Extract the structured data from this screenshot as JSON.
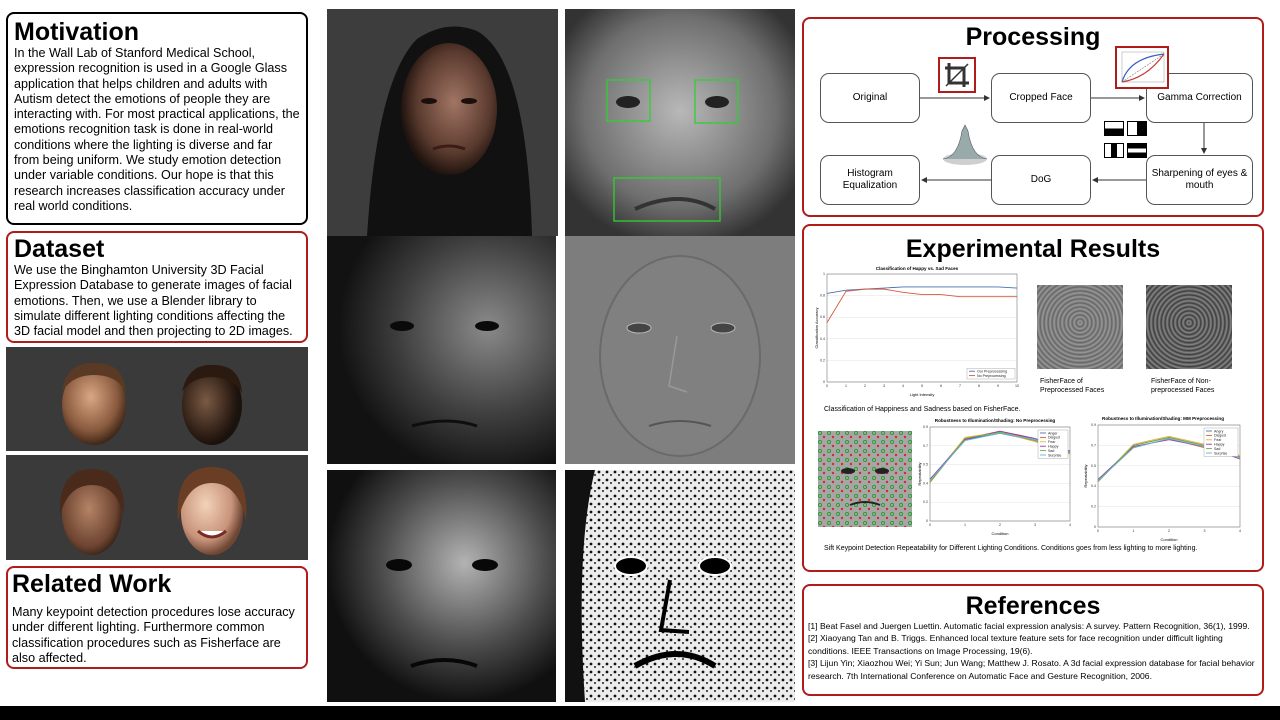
{
  "motivation": {
    "title": "Motivation",
    "body": "In the Wall Lab of Stanford Medical School, expression recognition is used in a Google Glass application that helps children and adults with Autism detect the emotions of people they are interacting with. For most practical applications, the emotions recognition task is done in real-world conditions where the lighting is diverse and far from being uniform. We study emotion detection under variable conditions. Our hope is that this research increases classification accuracy under real world conditions."
  },
  "dataset": {
    "title": "Dataset",
    "body": "We use the Binghamton University 3D Facial Expression Database to generate images of facial emotions. Then, we use a Blender library to simulate different lighting conditions affecting the 3D facial model and then projecting to 2D images."
  },
  "related_work": {
    "title": "Related Work",
    "body": "Many keypoint detection procedures lose accuracy under different lighting. Furthermore common classification procedures such as Fisherface are also affected."
  },
  "processing": {
    "title": "Processing",
    "nodes": {
      "original": "Original",
      "cropped": "Cropped Face",
      "gamma": "Gamma Correction",
      "histogram": "Histogram Equalization",
      "dog": "DoG",
      "sharpen": "Sharpening of eyes & mouth"
    }
  },
  "results": {
    "title": "Experimental Results",
    "fisher_caption": "Classification of Happiness and Sadness based on FisherFace.",
    "fisher_pre_caption": "FisherFace of Preprocessed Faces",
    "fisher_nonpre_caption": "FisherFace of Non-preprocessed Faces",
    "sift_caption": "Sift Keypoint Detection Repeatability for Different Lighting Conditions. Conditions goes from less lighting to more lighting."
  },
  "references": {
    "title": "References",
    "items": [
      "[1] Beat Fasel and Juergen Luettin. Automatic facial expression analysis: A survey. Pattern Recognition, 36(1), 1999.",
      "[2]  Xiaoyang Tan and B. Triggs. Enhanced local texture feature sets for face recognition under difficult lighting conditions. IEEE Transactions on Image Processing, 19(6).",
      "[3]  Lijun Yin; Xiaozhou Wei; Yi Sun; Jun Wang; Matthew J. Rosato. A 3d facial expression database for facial behavior research. 7th International Conference on Automatic Face and Gesture Recognition, 2006."
    ]
  },
  "chart_data": [
    {
      "type": "line",
      "title": "Classification of Happy vs. Sad Faces",
      "xlabel": "Light Intensity",
      "ylabel": "Classification Accuracy",
      "x": [
        0,
        1,
        2,
        3,
        4,
        5,
        6,
        7,
        8,
        9,
        10
      ],
      "xlim": [
        0,
        10
      ],
      "ylim": [
        0,
        1
      ],
      "legend": "bottom-right",
      "series": [
        {
          "name": "Our Preprocessing",
          "color": "#4a6fb3",
          "values": [
            0.82,
            0.85,
            0.86,
            0.87,
            0.88,
            0.88,
            0.88,
            0.88,
            0.88,
            0.88,
            0.87
          ]
        },
        {
          "name": "No Preprocessing",
          "color": "#d35b3c",
          "values": [
            0.55,
            0.84,
            0.86,
            0.86,
            0.83,
            0.81,
            0.81,
            0.79,
            0.79,
            0.79,
            0.79
          ]
        }
      ]
    },
    {
      "type": "line",
      "title": "Robustness to Illumination/Shading: No Preprocessing",
      "xlabel": "Condition",
      "ylabel": "Repeatability",
      "x": [
        0,
        1,
        2,
        3,
        4
      ],
      "xlim": [
        0,
        4
      ],
      "ylim": [
        0,
        0.9
      ],
      "legend": "top-right",
      "series": [
        {
          "name": "Anger",
          "color": "#4a6fb3",
          "values": [
            0.38,
            0.78,
            0.84,
            0.77,
            0.65
          ]
        },
        {
          "name": "Disgust",
          "color": "#d35b3c",
          "values": [
            0.37,
            0.79,
            0.86,
            0.78,
            0.66
          ]
        },
        {
          "name": "Fear",
          "color": "#e8b03a",
          "values": [
            0.38,
            0.8,
            0.85,
            0.76,
            0.64
          ]
        },
        {
          "name": "Happy",
          "color": "#8e3fa0",
          "values": [
            0.4,
            0.78,
            0.86,
            0.79,
            0.67
          ]
        },
        {
          "name": "Sad",
          "color": "#7aa83a",
          "values": [
            0.37,
            0.79,
            0.85,
            0.77,
            0.65
          ]
        },
        {
          "name": "Surprise",
          "color": "#5bb8d6",
          "values": [
            0.39,
            0.77,
            0.84,
            0.78,
            0.66
          ]
        }
      ]
    },
    {
      "type": "line",
      "title": "Robustness to Illumination/Shading: MM Preprocessing",
      "xlabel": "Condition",
      "ylabel": "Repeatability",
      "x": [
        0,
        1,
        2,
        3,
        4
      ],
      "xlim": [
        0,
        4
      ],
      "ylim": [
        0,
        0.9
      ],
      "legend": "top-right",
      "series": [
        {
          "name": "Angry",
          "color": "#4a6fb3",
          "values": [
            0.4,
            0.72,
            0.79,
            0.72,
            0.62
          ]
        },
        {
          "name": "Disgust",
          "color": "#d35b3c",
          "values": [
            0.41,
            0.7,
            0.78,
            0.7,
            0.61
          ]
        },
        {
          "name": "Fear",
          "color": "#e8b03a",
          "values": [
            0.4,
            0.73,
            0.8,
            0.73,
            0.63
          ]
        },
        {
          "name": "Happy",
          "color": "#8e3fa0",
          "values": [
            0.42,
            0.71,
            0.77,
            0.71,
            0.6
          ]
        },
        {
          "name": "Sad",
          "color": "#7aa83a",
          "values": [
            0.4,
            0.72,
            0.79,
            0.72,
            0.62
          ]
        },
        {
          "name": "Surprise",
          "color": "#5bb8d6",
          "values": [
            0.41,
            0.7,
            0.78,
            0.71,
            0.61
          ]
        }
      ]
    }
  ]
}
